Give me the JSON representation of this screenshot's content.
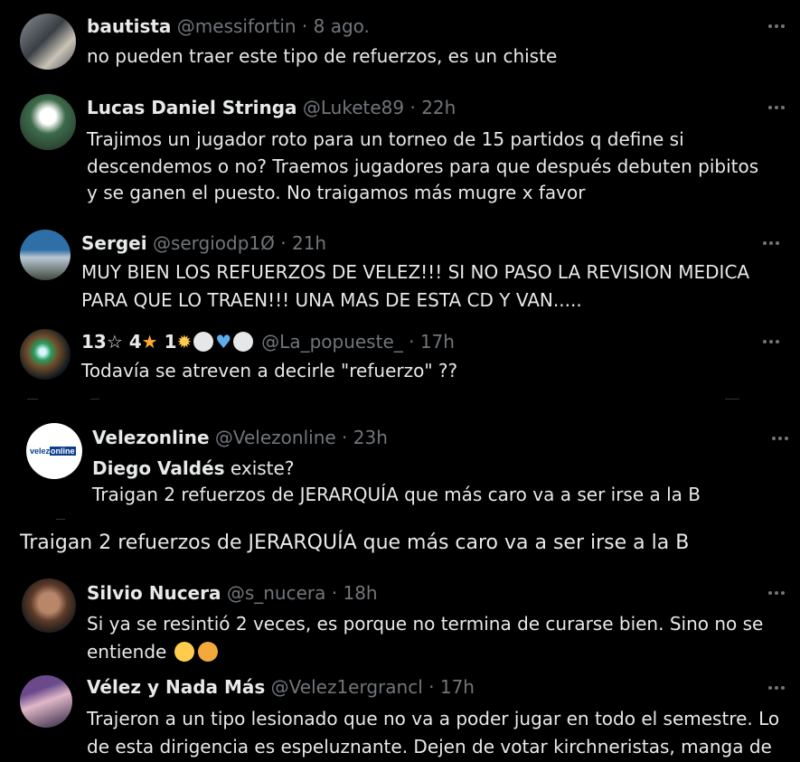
{
  "tweets": [
    {
      "name": "bautista",
      "handle": "@messifortin",
      "time": "8 ago.",
      "body": "no pueden traer este tipo de refuerzos, es un chiste"
    },
    {
      "name": "Lucas Daniel Stringa",
      "handle": "@Lukete89",
      "time": "22h",
      "body": [
        "Trajimos un jugador roto para un torneo de 15 partidos q define si",
        "descendemos o no? Traemos jugadores para que después debuten pibitos",
        "y se ganen el puesto. No traigamos más mugre x favor"
      ]
    },
    {
      "name": "Sergei",
      "handle": "@sergiodp1Ø",
      "time": "21h",
      "body": [
        "MUY BIEN LOS REFUERZOS DE VELEZ!!! SI NO PASO LA REVISION MEDICA",
        "PARA QUE LO TRAEN!!! UNA MAS DE ESTA CD Y VAN....."
      ]
    },
    {
      "name_parts": [
        "13",
        "4",
        "1"
      ],
      "handle": "@La_popueste_",
      "time": "17h",
      "body": "Todavía se atreven a decirle \"refuerzo\" ??"
    },
    {
      "name": "Velezonline",
      "handle": "@Velezonline",
      "time": "23h",
      "logo_text": "velez online",
      "quote_bold": "Diego Valdés",
      "quote_after": " existe?",
      "quote_line2": "Traigan 2 refuerzos de JERARQUÍA que más caro va a ser irse a la B"
    },
    {
      "standalone": "Traigan 2 refuerzos de JERARQUÍA que más caro va a ser irse a la B"
    },
    {
      "name": "Silvio Nucera",
      "handle": "@s_nucera",
      "time": "18h",
      "body": [
        "Si ya se resintió 2 veces, es porque no termina de curarse bien. Sino no se",
        "entiende"
      ]
    },
    {
      "name": "Vélez y Nada Más",
      "handle": "@Velez1ergrancl",
      "time": "17h",
      "body": [
        "Trajeron a un tipo lesionado que no va a poder jugar en todo el semestre. Lo",
        "de esta dirigencia es espeluznante. Dejen de votar kirchneristas, manga de"
      ]
    }
  ],
  "separator": "·",
  "icons": {
    "more": "more-icon",
    "emoji_rolling_eyes": "rolling-eyes-emoji",
    "emoji_thinking": "thinking-face-emoji",
    "star": "star-emoji",
    "sparkle": "sparkle-emoji",
    "white_circle": "white-circle-emoji",
    "blue_heart": "blue-heart-emoji",
    "outline_star": "outline-star-symbol"
  }
}
